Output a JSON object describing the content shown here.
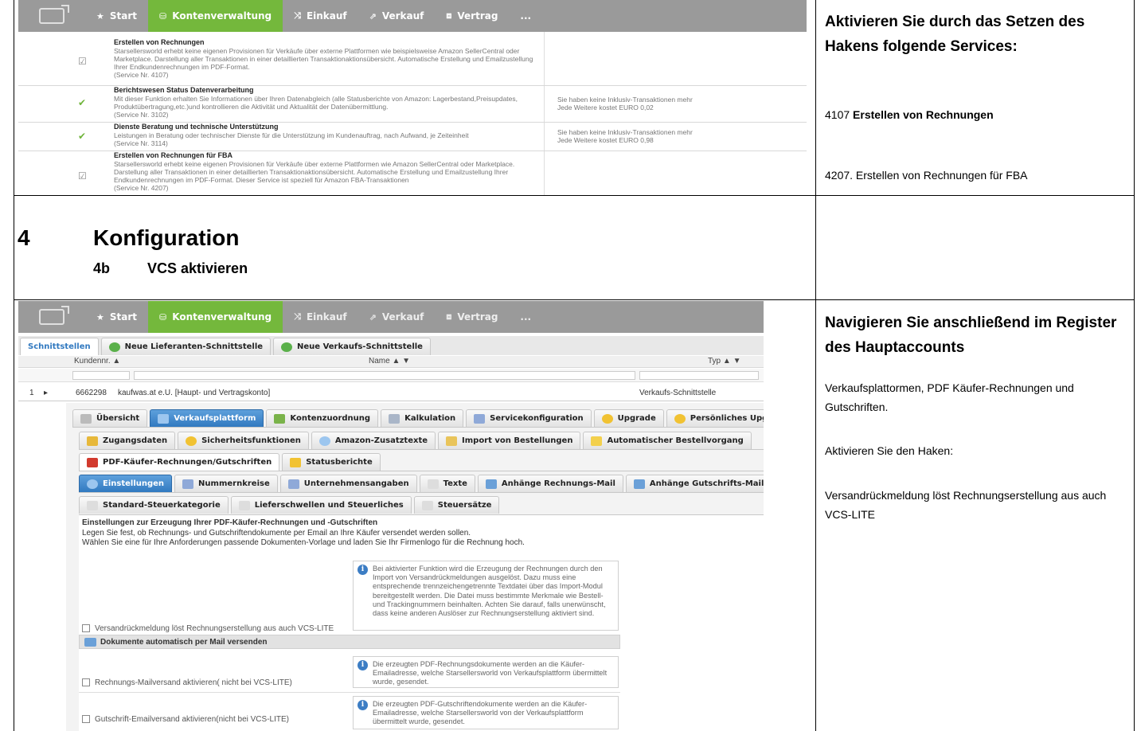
{
  "nav": {
    "items": [
      {
        "icon": "★",
        "label": "Start",
        "active": false
      },
      {
        "icon": "⛁",
        "label": "Kontenverwaltung",
        "active": true
      },
      {
        "icon": "⤨",
        "label": "Einkauf",
        "active": false
      },
      {
        "icon": "⇗",
        "label": "Verkauf",
        "active": false
      },
      {
        "icon": "⧈",
        "label": "Vertrag",
        "active": false
      },
      {
        "icon": "",
        "label": "...",
        "active": false
      }
    ]
  },
  "services": [
    {
      "title": "Erstellen von Rechnungen",
      "text": "Starsellersworld erhebt keine eigenen Provisionen für Verkäufe über externe Plattformen wie beispielsweise Amazon SellerCentral oder Marketplace. Darstellung aller Transaktionen in einer detaillierten Transaktionaktionsübersicht. Automatische Erstellung und Emailzustellung Ihrer Endkundenrechnungen im PDF-Format.",
      "service": "(Service Nr. 4107)",
      "mark": "☑",
      "info1": "",
      "info2": ""
    },
    {
      "title": "Berichtswesen Status Datenverarbeitung",
      "text": "Mit dieser Funktion erhalten Sie Informationen über Ihren Datenabgleich (alle Statusberichte von Amazon: Lagerbestand,Preisupdates, Produktübertragung,etc.)und kontrollieren die Aktivität und Aktualität der Datenübermittlung.",
      "service": "(Service Nr. 3102)",
      "mark": "✔",
      "info1": "Sie haben keine Inklusiv-Transaktionen mehr",
      "info2": "Jede Weitere kostet EURO 0,02"
    },
    {
      "title": "Dienste Beratung und technische Unterstützung",
      "text": "Leistungen in Beratung oder technischer Dienste für die Unterstützung im Kundenauftrag, nach Aufwand, je Zeiteinheit",
      "service": "(Service Nr. 3114)",
      "mark": "✔",
      "info1": "Sie haben keine Inklusiv-Transaktionen mehr",
      "info2": "Jede Weitere kostet EURO 0,98"
    },
    {
      "title": "Erstellen von Rechnungen für FBA",
      "text": "Starsellersworld erhebt keine eigenen Provisionen für Verkäufe über externe Plattformen wie Amazon SellerCentral oder Marketplace. Darstellung aller Transaktionen in einer detaillierten Transaktionaktionsübersicht. Automatische Erstellung und Emailzustellung Ihrer Endkundenrechnungen im PDF-Format. Dieser Service ist speziell für Amazon FBA-Transaktionen",
      "service": "(Service Nr. 4207)",
      "mark": "☑",
      "info1": "",
      "info2": ""
    }
  ],
  "right1": {
    "title": "Aktivieren Sie durch das Setzen des Hakens folgende Services:",
    "line1_num": "4107",
    "line1_bold": "Erstellen von Rechnungen",
    "line2": "4207. Erstellen von Rechnungen für FBA"
  },
  "section": {
    "num": "4",
    "title": "Konfiguration",
    "sub_num": "4b",
    "sub_title": "VCS aktivieren"
  },
  "right2": {
    "title": "Navigieren Sie anschließend im Register des Hauptaccounts",
    "p1": "Verkaufsplattormen, PDF Käufer-Rechnungen und Gutschriften.",
    "p2": "Aktivieren Sie den Haken:",
    "p3": "Versandrückmeldung löst Rechnungserstellung aus auch VCS-LITE"
  },
  "lower": {
    "top_tabs": [
      "Schnittstellen",
      "Neue Lieferanten-Schnittstelle",
      "Neue Verkaufs-Schnittstelle"
    ],
    "grid": {
      "col_kunden": "Kundennr. ▲",
      "col_name": "Name ▲ ▼",
      "col_typ": "Typ ▲ ▼",
      "row_num": "1",
      "row_arrow": "▸",
      "row_kunden": "6662298",
      "row_name": "kaufwas.at e.U. [Haupt- und Vertragskonto]",
      "row_typ": "Verkaufs-Schnittstelle"
    },
    "tabs1": [
      "Übersicht",
      "Verkaufsplattform",
      "Kontenzuordnung",
      "Kalkulation",
      "Servicekonfiguration",
      "Upgrade",
      "Persönliches Upgrade"
    ],
    "tabs2": [
      "Zugangsdaten",
      "Sicherheitsfunktionen",
      "Amazon-Zusatztexte",
      "Import von Bestellungen",
      "Automatischer Bestellvorgang"
    ],
    "tabs3": [
      "PDF-Käufer-Rechnungen/Gutschriften",
      "Statusberichte"
    ],
    "tabs4": [
      "Einstellungen",
      "Nummernkreise",
      "Unternehmensangaben",
      "Texte",
      "Anhänge Rechnungs-Mail",
      "Anhänge Gutschrifts-Mail"
    ],
    "tabs5": [
      "Standard-Steuerkategorie",
      "Lieferschwellen und Steuerliches",
      "Steuersätze"
    ],
    "settings_title": "Einstellungen zur Erzeugung Ihrer PDF-Käufer-Rechnungen und -Gutschriften",
    "settings_p1": "Legen Sie fest, ob Rechnungs- und Gutschriftendokumente per Email an Ihre Käufer versendet werden sollen.",
    "settings_p2": "Wählen Sie eine für Ihre Anforderungen passende Dokumenten-Vorlage und laden Sie Ihr Firmenlogo für die Rechnung hoch.",
    "opt1_label": "Versandrückmeldung löst Rechnungserstellung aus auch VCS-LITE",
    "opt1_info": "Bei aktivierter Funktion wird die Erzeugung der Rechnungen durch den Import von Versandrückmeldungen ausgelöst. Dazu muss eine entsprechende trennzeichengetrennte Textdatei über das Import-Modul bereitgestellt werden. Die Datei muss bestimmte Merkmale wie Bestell- und Trackingnummern beinhalten. Achten Sie darauf, falls unerwünscht, dass keine anderen Auslöser zur Rechnungserstellung aktiviert sind.",
    "mail_header": "Dokumente automatisch per Mail versenden",
    "opt2_label": "Rechnungs-Mailversand aktivieren( nicht bei VCS-LITE)",
    "opt2_info": "Die erzeugten PDF-Rechnungsdokumente werden an die Käufer-Emailadresse, welche Starsellersworld von Verkaufsplattform übermittelt wurde, gesendet.",
    "opt3_label": "Gutschrift-Emailversand aktivieren(nicht bei VCS-LITE)",
    "opt3_info": "Die erzeugten PDF-Gutschriftendokumente werden an die Käufer-Emailadresse, welche Starsellersworld von der Verkaufsplattform übermittelt wurde, gesendet."
  }
}
